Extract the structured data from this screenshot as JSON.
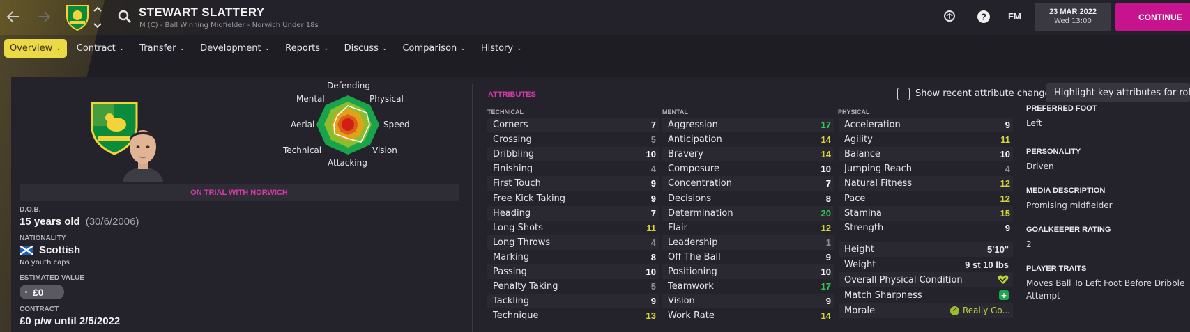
{
  "header": {
    "player_name": "STEWART SLATTERY",
    "subtitle": "M (C) - Ball Winning Midfielder - Norwich Under 18s",
    "fm_label": "FM",
    "date": "23 MAR 2022",
    "day_time": "Wed 13:00",
    "continue_label": "CONTINUE",
    "help_glyph": "?"
  },
  "tabs": [
    {
      "label": "Overview",
      "active": true
    },
    {
      "label": "Contract"
    },
    {
      "label": "Transfer"
    },
    {
      "label": "Development"
    },
    {
      "label": "Reports"
    },
    {
      "label": "Discuss"
    },
    {
      "label": "Comparison"
    },
    {
      "label": "History"
    }
  ],
  "polar": {
    "labels": {
      "top": "Defending",
      "top_left": "Mental",
      "top_right": "Physical",
      "left": "Aerial",
      "right": "Speed",
      "bottom_left": "Technical",
      "bottom_right": "Vision",
      "bottom": "Attacking"
    }
  },
  "profile": {
    "trial_text": "ON TRIAL WITH NORWICH",
    "dob_label": "D.O.B.",
    "age": "15 years old",
    "dob": "(30/6/2006)",
    "nationality_label": "NATIONALITY",
    "nationality": "Scottish",
    "youth_caps": "No youth caps",
    "value_label": "ESTIMATED VALUE",
    "value": "£0",
    "contract_label": "CONTRACT",
    "contract": "£0 p/w until 2/5/2022"
  },
  "attributes": {
    "title": "ATTRIBUTES",
    "show_changes_label": "Show recent attribute changes",
    "highlight_label": "Highlight key attributes for role",
    "technical_head": "TECHNICAL",
    "mental_head": "MENTAL",
    "physical_head": "PHYSICAL",
    "technical": [
      {
        "name": "Corners",
        "value": "7"
      },
      {
        "name": "Crossing",
        "value": "5"
      },
      {
        "name": "Dribbling",
        "value": "10"
      },
      {
        "name": "Finishing",
        "value": "4"
      },
      {
        "name": "First Touch",
        "value": "9"
      },
      {
        "name": "Free Kick Taking",
        "value": "9"
      },
      {
        "name": "Heading",
        "value": "7"
      },
      {
        "name": "Long Shots",
        "value": "11"
      },
      {
        "name": "Long Throws",
        "value": "4"
      },
      {
        "name": "Marking",
        "value": "8"
      },
      {
        "name": "Passing",
        "value": "10"
      },
      {
        "name": "Penalty Taking",
        "value": "5"
      },
      {
        "name": "Tackling",
        "value": "9"
      },
      {
        "name": "Technique",
        "value": "13"
      }
    ],
    "mental": [
      {
        "name": "Aggression",
        "value": "17"
      },
      {
        "name": "Anticipation",
        "value": "14"
      },
      {
        "name": "Bravery",
        "value": "14"
      },
      {
        "name": "Composure",
        "value": "10"
      },
      {
        "name": "Concentration",
        "value": "7"
      },
      {
        "name": "Decisions",
        "value": "8"
      },
      {
        "name": "Determination",
        "value": "20"
      },
      {
        "name": "Flair",
        "value": "12"
      },
      {
        "name": "Leadership",
        "value": "1"
      },
      {
        "name": "Off The Ball",
        "value": "9"
      },
      {
        "name": "Positioning",
        "value": "10"
      },
      {
        "name": "Teamwork",
        "value": "17"
      },
      {
        "name": "Vision",
        "value": "9"
      },
      {
        "name": "Work Rate",
        "value": "14"
      }
    ],
    "physical": [
      {
        "name": "Acceleration",
        "value": "9"
      },
      {
        "name": "Agility",
        "value": "11"
      },
      {
        "name": "Balance",
        "value": "10"
      },
      {
        "name": "Jumping Reach",
        "value": "4"
      },
      {
        "name": "Natural Fitness",
        "value": "12"
      },
      {
        "name": "Pace",
        "value": "12"
      },
      {
        "name": "Stamina",
        "value": "15"
      },
      {
        "name": "Strength",
        "value": "9"
      }
    ],
    "extra": {
      "height_label": "Height",
      "height": "5'10\"",
      "weight_label": "Weight",
      "weight": "9 st 10 lbs",
      "condition_label": "Overall Physical Condition",
      "sharpness_label": "Match Sharpness",
      "morale_label": "Morale",
      "morale": "Really Go..."
    }
  },
  "side": {
    "foot_label": "PREFERRED FOOT",
    "foot": "Left",
    "personality_label": "PERSONALITY",
    "personality": "Driven",
    "media_label": "MEDIA DESCRIPTION",
    "media": "Promising midfielder",
    "gk_label": "GOALKEEPER RATING",
    "gk": "2",
    "traits_label": "PLAYER TRAITS",
    "traits": "Moves Ball To Left Foot Before Dribble Attempt"
  },
  "colors": {
    "accent_pink": "#c8138f",
    "tab_active": "#ecd946",
    "good_green": "#2ecc52",
    "good_yellow": "#d9d43a",
    "mid_gray": "#8c8b94"
  }
}
